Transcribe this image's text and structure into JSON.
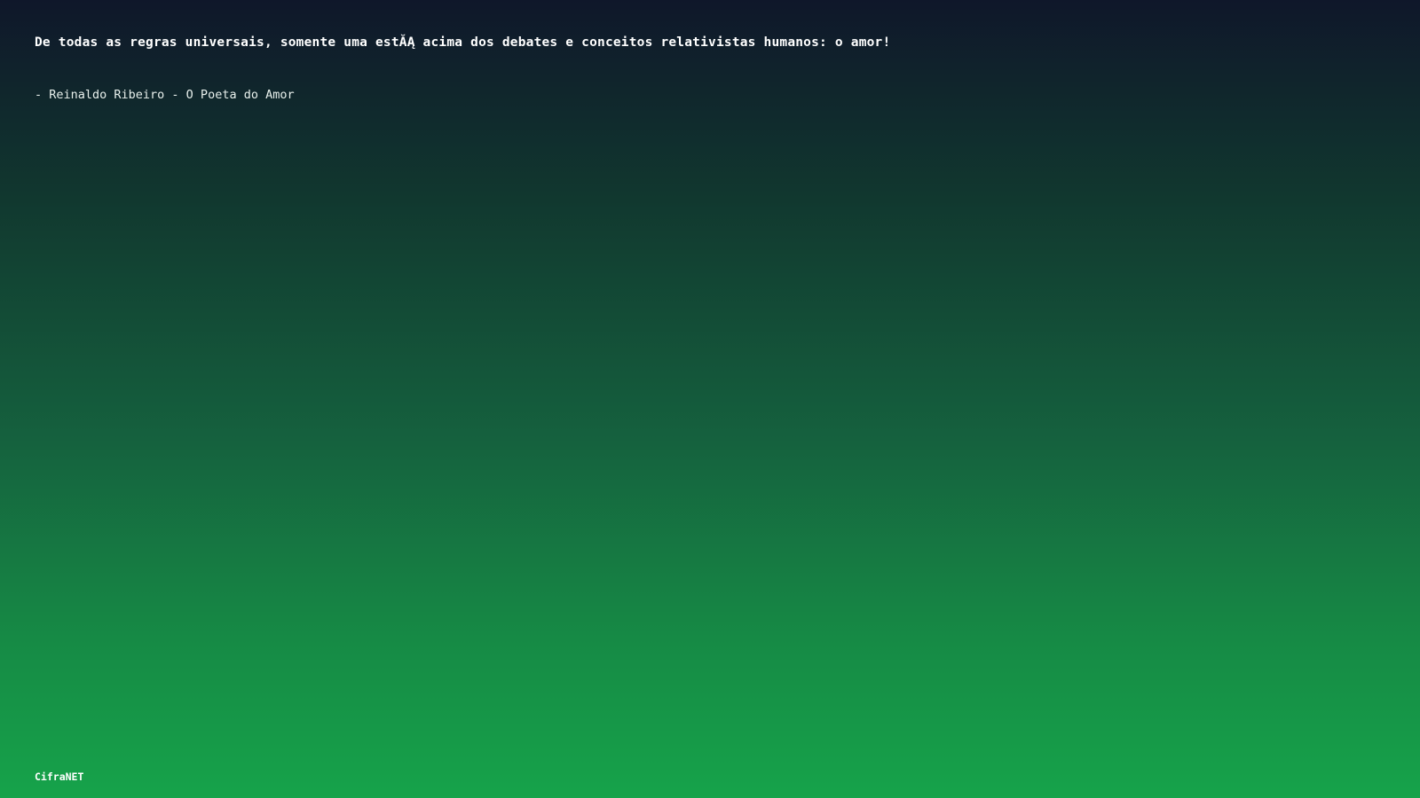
{
  "quote": {
    "text": "De todas as regras universais, somente uma estĂĄ acima dos debates e conceitos relativistas humanos: o amor!",
    "author": "- Reinaldo Ribeiro - O Poeta do Amor"
  },
  "footer": {
    "brand": "CifraNET"
  },
  "colors": {
    "background_top": "#0f172a",
    "background_bottom": "#16a34a",
    "text": "#ffffff"
  }
}
